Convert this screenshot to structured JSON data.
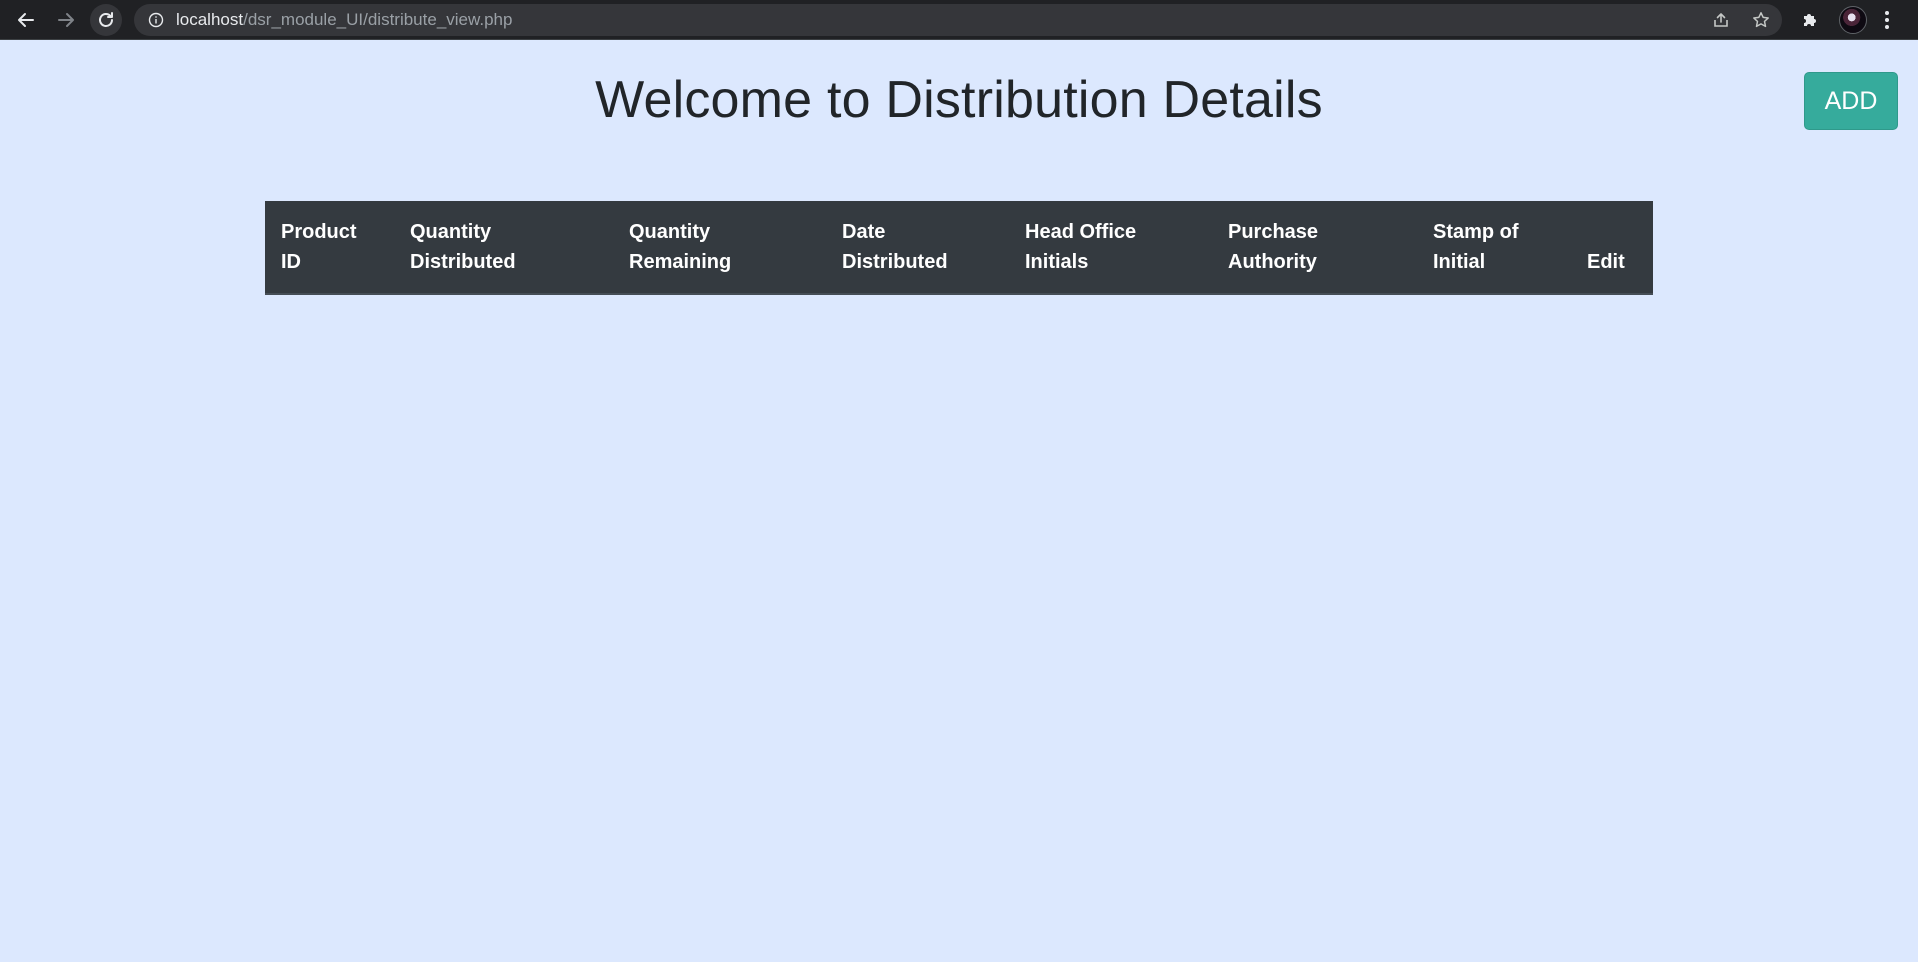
{
  "browser": {
    "url_host": "localhost",
    "url_path": "/dsr_module_UI/distribute_view.php"
  },
  "page": {
    "title": "Welcome to Distribution Details",
    "add_label": "ADD"
  },
  "table": {
    "headers": [
      {
        "line1": "Product",
        "line2": "ID"
      },
      {
        "line1": "Quantity",
        "line2": "Distributed"
      },
      {
        "line1": "Quantity",
        "line2": "Remaining"
      },
      {
        "line1": "Date",
        "line2": "Distributed"
      },
      {
        "line1": "Head Office",
        "line2": "Initials"
      },
      {
        "line1": "Purchase",
        "line2": "Authority"
      },
      {
        "line1": "Stamp of",
        "line2": "Initial"
      },
      {
        "line1": "",
        "line2": "Edit"
      }
    ],
    "rows": []
  },
  "colors": {
    "page_background": "#dce8fe",
    "header_background": "#343a40",
    "add_button": "#36ab9c"
  }
}
